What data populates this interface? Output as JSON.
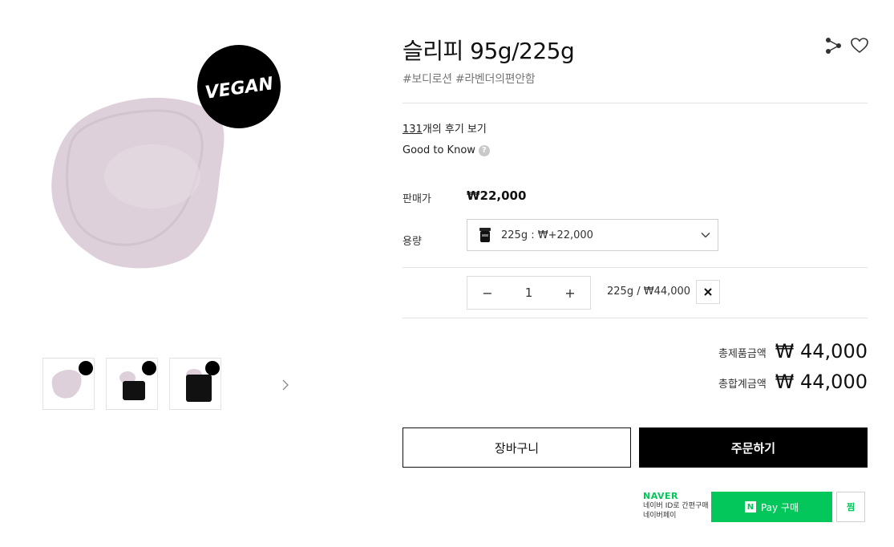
{
  "product": {
    "title": "슬리피 95g/225g",
    "tags": "#보디로션 #라벤더의편안함",
    "badge_text": "VEGAN"
  },
  "reviews": {
    "count": "131",
    "suffix": "개의 후기 보기"
  },
  "good_to_know": {
    "label": "Good to Know",
    "help_glyph": "?"
  },
  "price": {
    "label": "판매가",
    "value": "₩22,000"
  },
  "volume": {
    "label": "용량",
    "selected": "225g : ₩+22,000"
  },
  "quantity": {
    "minus": "−",
    "value": "1",
    "plus": "+",
    "summary": "225g / ₩44,000",
    "remove_glyph": "✕"
  },
  "totals": {
    "product_label": "총제품금액",
    "product_value": "₩ 44,000",
    "sum_label": "총합계금액",
    "sum_value": "₩ 44,000"
  },
  "actions": {
    "cart": "장바구니",
    "order": "주문하기"
  },
  "naver": {
    "brand": "NAVER",
    "sub1": "네이버 ID로 간편구매",
    "sub2": "네이버페이",
    "pay_n": "N",
    "pay_label": "Pay 구매",
    "wish": "찜"
  },
  "thumbnails": [
    {
      "name": "thumb-product-swatch"
    },
    {
      "name": "thumb-product-jar-open"
    },
    {
      "name": "thumb-product-jar"
    }
  ],
  "colors": {
    "lotion": "#ddd0da",
    "naver_green": "#03c75a",
    "black": "#000000"
  }
}
